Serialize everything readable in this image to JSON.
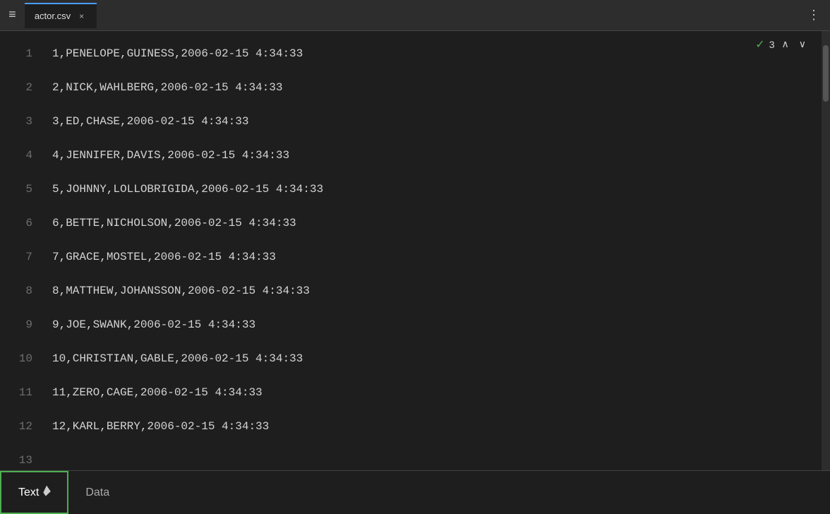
{
  "titlebar": {
    "hamburger": "≡",
    "tab_name": "actor.csv",
    "tab_close": "×",
    "more_options": "⋮"
  },
  "match": {
    "check": "✓",
    "count": "3",
    "up_arrow": "∧",
    "down_arrow": "∨"
  },
  "lines": [
    {
      "num": "1",
      "content": "1,PENELOPE,GUINESS,2006-02-15 4:34:33"
    },
    {
      "num": "2",
      "content": "2,NICK,WAHLBERG,2006-02-15 4:34:33"
    },
    {
      "num": "3",
      "content": "3,ED,CHASE,2006-02-15 4:34:33"
    },
    {
      "num": "4",
      "content": "4,JENNIFER,DAVIS,2006-02-15 4:34:33"
    },
    {
      "num": "5",
      "content": "5,JOHNNY,LOLLOBRIGIDA,2006-02-15 4:34:33"
    },
    {
      "num": "6",
      "content": "6,BETTE,NICHOLSON,2006-02-15 4:34:33"
    },
    {
      "num": "7",
      "content": "7,GRACE,MOSTEL,2006-02-15 4:34:33"
    },
    {
      "num": "8",
      "content": "8,MATTHEW,JOHANSSON,2006-02-15 4:34:33"
    },
    {
      "num": "9",
      "content": "9,JOE,SWANK,2006-02-15 4:34:33"
    },
    {
      "num": "10",
      "content": "10,CHRISTIAN,GABLE,2006-02-15 4:34:33"
    },
    {
      "num": "11",
      "content": "11,ZERO,CAGE,2006-02-15 4:34:33"
    },
    {
      "num": "12",
      "content": "12,KARL,BERRY,2006-02-15 4:34:33"
    },
    {
      "num": "13",
      "content": ""
    }
  ],
  "bottom_tabs": [
    {
      "id": "text",
      "label": "Text",
      "active": true
    },
    {
      "id": "data",
      "label": "Data",
      "active": false
    }
  ]
}
